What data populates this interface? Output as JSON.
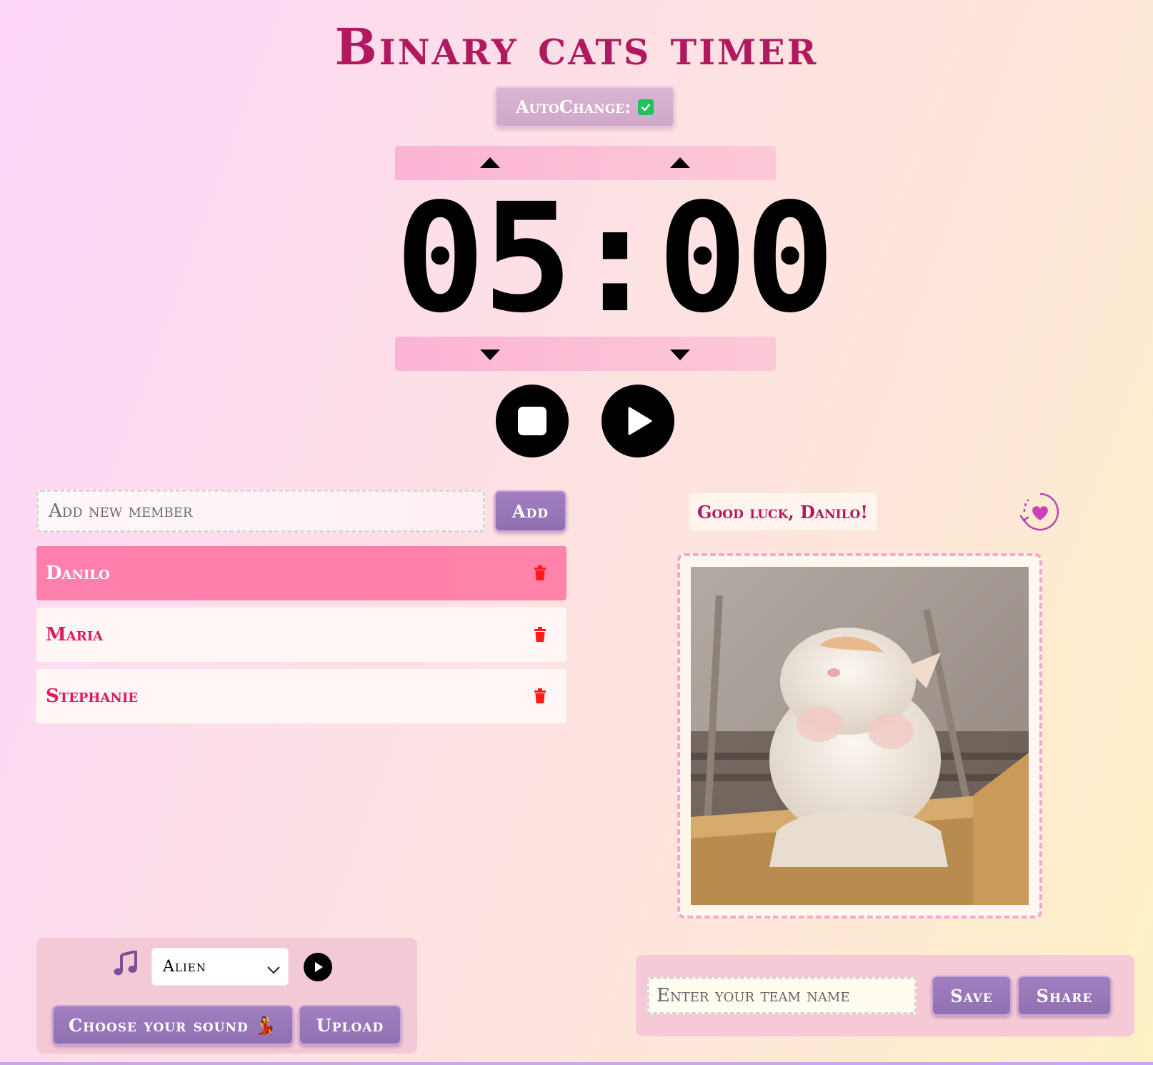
{
  "title": "Binary cats timer",
  "autochange": {
    "label": "AutoChange:",
    "checked": true
  },
  "timer": {
    "display": "05:00"
  },
  "members": {
    "input_placeholder": "Add new member",
    "add_label": "Add",
    "list": [
      {
        "name": "Danilo",
        "active": true
      },
      {
        "name": "Maria",
        "active": false
      },
      {
        "name": "Stephanie",
        "active": false
      }
    ]
  },
  "message": "Good luck, Danilo!",
  "sound": {
    "selected": "Alien",
    "choose_label": "Choose your sound 💃",
    "upload_label": "Upload"
  },
  "team": {
    "input_placeholder": "Enter your team name",
    "save_label": "Save",
    "share_label": "Share"
  },
  "colors": {
    "title": "#b0195e",
    "active_member": "#ff80aa",
    "member_text": "#e0195e",
    "button_purple": "#9a78b8",
    "trash": "#ff1a1a"
  }
}
